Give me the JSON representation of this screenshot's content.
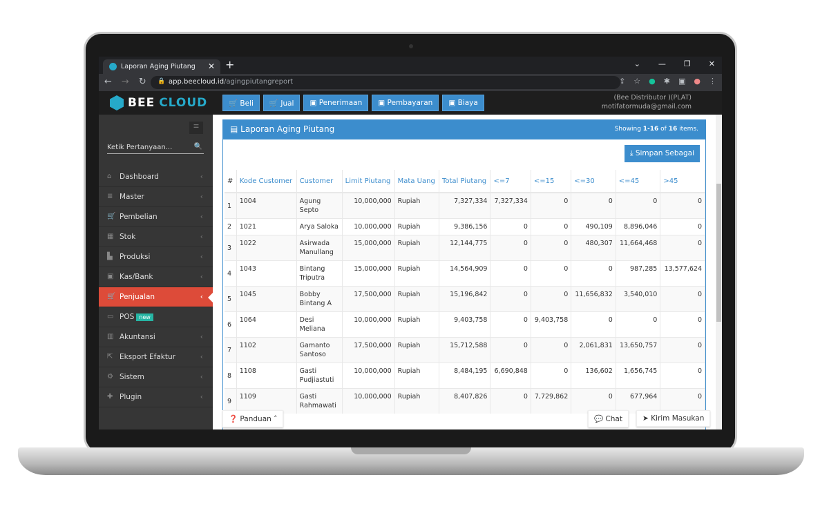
{
  "browser": {
    "tab_title": "Laporan Aging Piutang",
    "url_host": "app.beecloud.id",
    "url_path": "/agingpiutangreport"
  },
  "app": {
    "logo_a": "BEE",
    "logo_b": "CLOUD",
    "user_company": "(Bee Distributor )(PLAT)",
    "user_email": "motifatormuda@gmail.com",
    "top_buttons": [
      "Beli",
      "Jual",
      "Penerimaan",
      "Pembayaran",
      "Biaya"
    ]
  },
  "sidebar": {
    "search_placeholder": "Ketik Pertanyaan...",
    "items": [
      {
        "label": "Dashboard",
        "icon": "home-icon"
      },
      {
        "label": "Master",
        "icon": "database-icon"
      },
      {
        "label": "Pembelian",
        "icon": "cart-icon"
      },
      {
        "label": "Stok",
        "icon": "archive-icon"
      },
      {
        "label": "Produksi",
        "icon": "factory-icon"
      },
      {
        "label": "Kas/Bank",
        "icon": "money-icon"
      },
      {
        "label": "Penjualan",
        "icon": "cart-icon",
        "active": true
      },
      {
        "label": "POS",
        "icon": "monitor-icon",
        "badge": "new"
      },
      {
        "label": "Akuntansi",
        "icon": "chart-icon"
      },
      {
        "label": "Eksport Efaktur",
        "icon": "export-icon"
      },
      {
        "label": "Sistem",
        "icon": "gears-icon"
      },
      {
        "label": "Plugin",
        "icon": "puzzle-icon"
      }
    ]
  },
  "report": {
    "title": "Laporan Aging Piutang",
    "showing_pre": "Showing ",
    "showing_range": "1-16",
    "showing_mid": " of ",
    "showing_total": "16",
    "showing_post": " items.",
    "save_label": "Simpan Sebagai",
    "columns": [
      "#",
      "Kode Customer",
      "Customer",
      "Limit Piutang",
      "Mata Uang",
      "Total Piutang",
      "<=7",
      "<=15",
      "<=30",
      "<=45",
      ">45"
    ],
    "rows": [
      [
        "1",
        "1004",
        "Agung Septo",
        "10,000,000",
        "Rupiah",
        "7,327,334",
        "7,327,334",
        "0",
        "0",
        "0",
        "0"
      ],
      [
        "2",
        "1021",
        "Arya Saloka",
        "10,000,000",
        "Rupiah",
        "9,386,156",
        "0",
        "0",
        "490,109",
        "8,896,046",
        "0"
      ],
      [
        "3",
        "1022",
        "Asirwada Manullang",
        "15,000,000",
        "Rupiah",
        "12,144,775",
        "0",
        "0",
        "480,307",
        "11,664,468",
        "0"
      ],
      [
        "4",
        "1043",
        "Bintang Triputra",
        "15,000,000",
        "Rupiah",
        "14,564,909",
        "0",
        "0",
        "0",
        "987,285",
        "13,577,624"
      ],
      [
        "5",
        "1045",
        "Bobby Bintang A",
        "17,500,000",
        "Rupiah",
        "15,196,842",
        "0",
        "0",
        "11,656,832",
        "3,540,010",
        "0"
      ],
      [
        "6",
        "1064",
        "Desi Meliana",
        "10,000,000",
        "Rupiah",
        "9,403,758",
        "0",
        "9,403,758",
        "0",
        "0",
        "0"
      ],
      [
        "7",
        "1102",
        "Gamanto Santoso",
        "17,500,000",
        "Rupiah",
        "15,712,588",
        "0",
        "0",
        "2,061,831",
        "13,650,757",
        "0"
      ],
      [
        "8",
        "1108",
        "Gasti Pudjiastuti",
        "10,000,000",
        "Rupiah",
        "8,484,195",
        "6,690,848",
        "0",
        "136,602",
        "1,656,745",
        "0"
      ],
      [
        "9",
        "1109",
        "Gasti Rahmawati",
        "10,000,000",
        "Rupiah",
        "8,407,826",
        "0",
        "7,729,862",
        "0",
        "677,964",
        "0"
      ]
    ]
  },
  "footer": {
    "guide": "Panduan",
    "chat": "Chat",
    "feedback": "Kirim Masukan"
  }
}
